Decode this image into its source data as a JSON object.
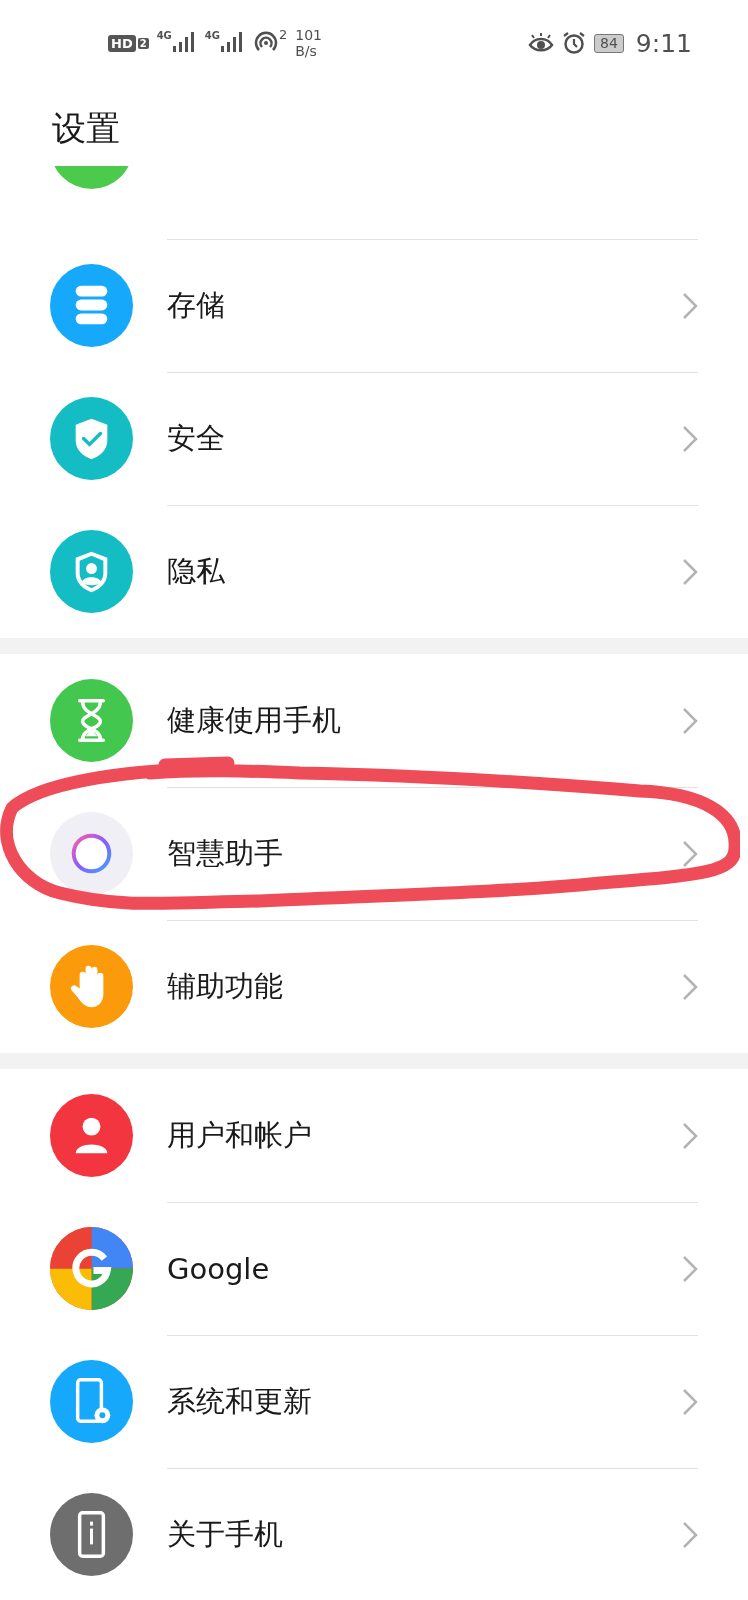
{
  "status_bar": {
    "hd_badge": "HD",
    "hd_sub": "2",
    "sim1": "4G",
    "sim2": "4G",
    "hotspot_count": "2",
    "speed_value": "101",
    "speed_unit": "B/s",
    "battery": "84",
    "time": "9:11"
  },
  "title": "设置",
  "clipped_row": {
    "color": "#4cca4c"
  },
  "groups": [
    {
      "items": [
        {
          "label": "存储",
          "color": "#16a9fb",
          "circled": false
        },
        {
          "label": "安全",
          "color": "#14bcc4",
          "circled": false
        },
        {
          "label": "隐私",
          "color": "#14bcc4",
          "circled": false
        }
      ]
    },
    {
      "items": [
        {
          "label": "健康使用手机",
          "color": "#44c74e",
          "circled": false
        },
        {
          "label": "智慧助手",
          "color": "#f0eff6",
          "circled": true
        },
        {
          "label": "辅助功能",
          "color": "#fb9a0a",
          "circled": false
        }
      ]
    },
    {
      "items": [
        {
          "label": "用户和帐户",
          "color": "#f2353e",
          "circled": false
        },
        {
          "label": "Google",
          "color": "#ea4335",
          "circled": false
        },
        {
          "label": "系统和更新",
          "color": "#16a9fb",
          "circled": false
        },
        {
          "label": "关于手机",
          "color": "#6e6e6e",
          "circled": false
        }
      ]
    }
  ]
}
